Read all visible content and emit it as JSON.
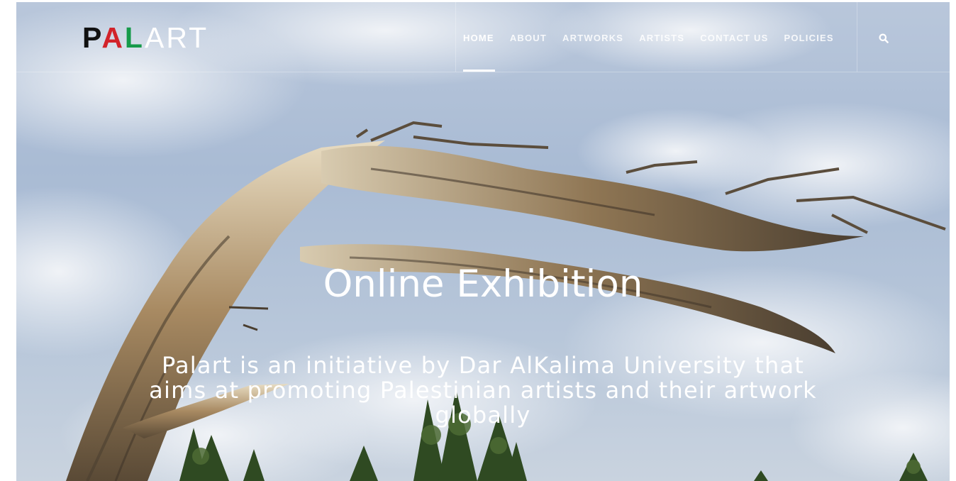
{
  "brand": {
    "part1": "P",
    "part2": "A",
    "part3": "L",
    "part4": "ART",
    "colors": {
      "p": "#111111",
      "a": "#d2232a",
      "l": "#169a4a",
      "art": "#ffffff"
    }
  },
  "nav": {
    "items": [
      {
        "label": "HOME",
        "active": true
      },
      {
        "label": "ABOUT",
        "active": false
      },
      {
        "label": "ARTWORKS",
        "active": false
      },
      {
        "label": "ARTISTS",
        "active": false
      },
      {
        "label": "CONTACT US",
        "active": false
      },
      {
        "label": "POLICIES",
        "active": false
      }
    ],
    "search_icon": "search-icon"
  },
  "hero": {
    "title": "Online Exhibition",
    "subtitle": "Palart is an initiative by Dar AlKalima University that aims at promoting Palestinian artists and their artwork globally",
    "image": "dead-tree-branch-against-cloudy-sky"
  }
}
